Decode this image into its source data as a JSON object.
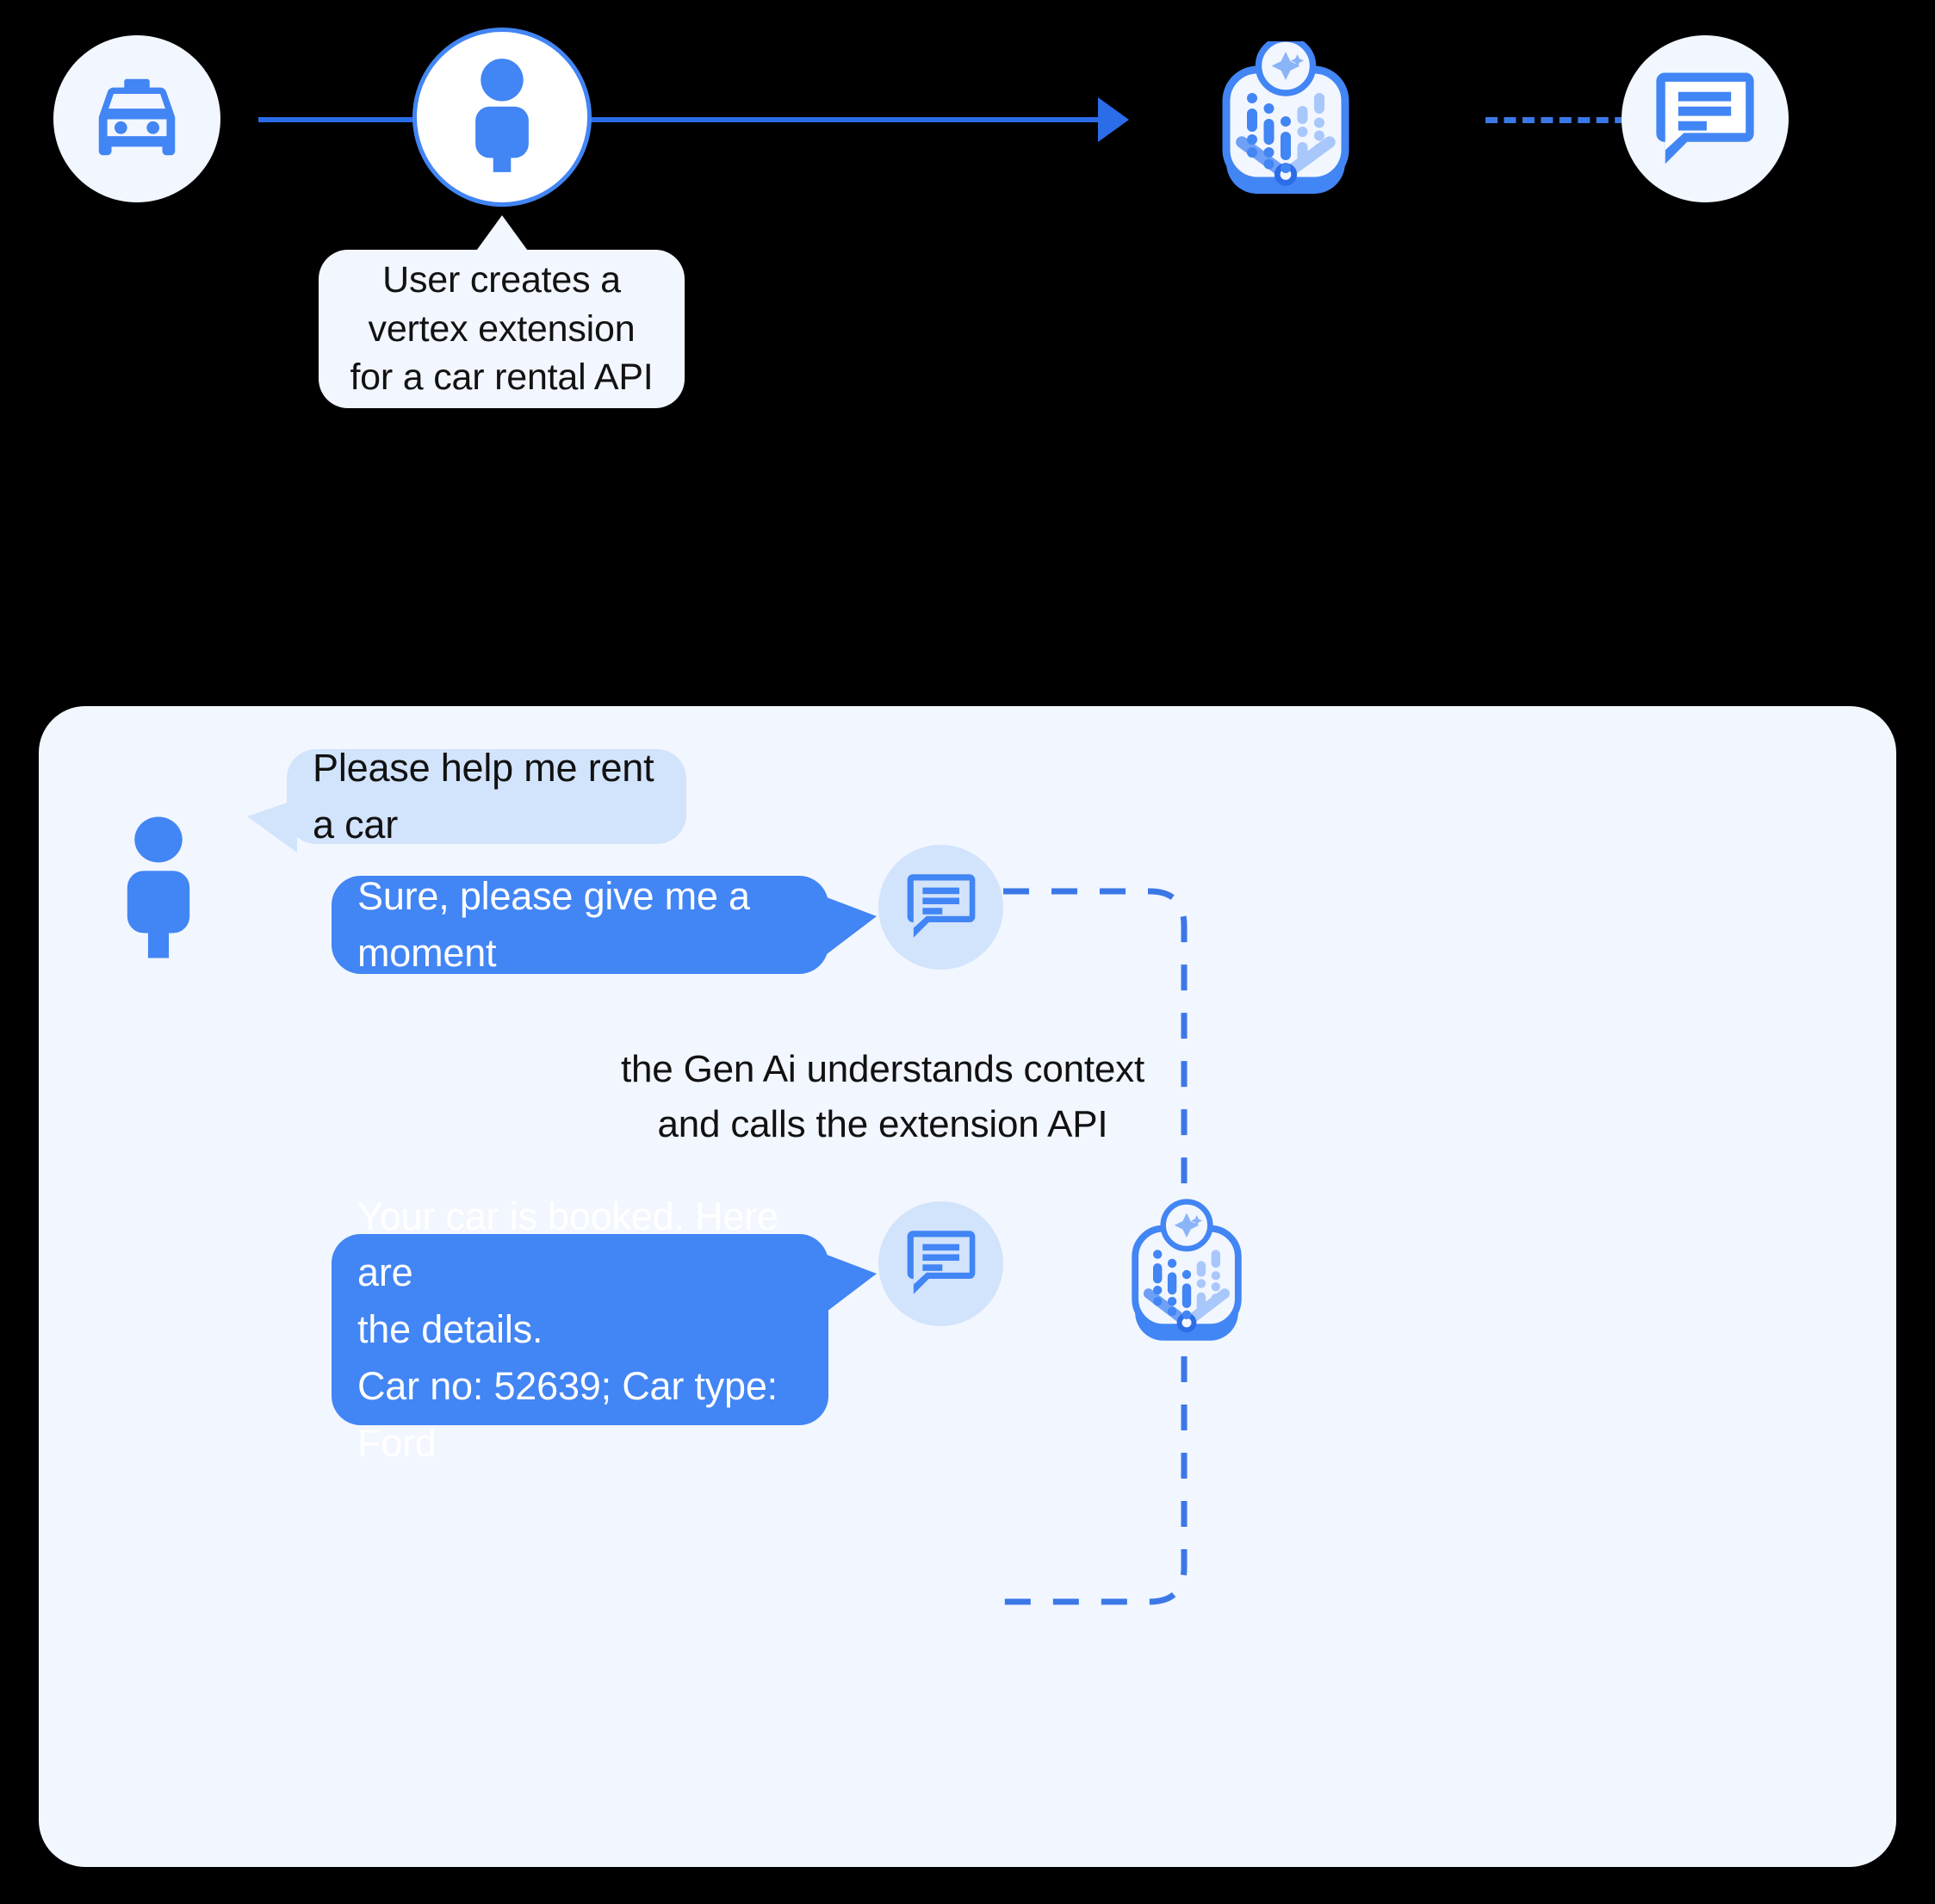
{
  "colors": {
    "background": "#000000",
    "accent_blue": "#4285F4",
    "line_blue": "#2B6CE8",
    "panel_bg": "#F2F6FE",
    "user_bubble_bg": "#D2E3FC",
    "text_dark": "#111111",
    "text_light": "#FFFFFF"
  },
  "flow": {
    "nodes": [
      {
        "name": "taxi-icon",
        "label": "taxi-icon"
      },
      {
        "name": "user-icon",
        "label": "person-icon"
      },
      {
        "name": "vertex-extension-icon",
        "label": "vertex-extension-icon"
      },
      {
        "name": "chat-icon",
        "label": "chat-bubble-icon"
      }
    ],
    "callout": {
      "lines": [
        "User creates a",
        "vertex extension",
        "for a car rental API"
      ]
    }
  },
  "chat": {
    "messages": [
      {
        "id": "msg-user-1",
        "author": "user",
        "text": "Please help me rent a car"
      },
      {
        "id": "msg-bot-1",
        "author": "assistant",
        "text": "Sure, please give me a moment"
      },
      {
        "id": "msg-bot-2",
        "author": "assistant",
        "text": "Your car is booked. Here are\nthe details.\nCar no: 52639; Car type: Ford"
      }
    ],
    "annotation": "the Gen Ai understands context\nand calls the extension API"
  }
}
